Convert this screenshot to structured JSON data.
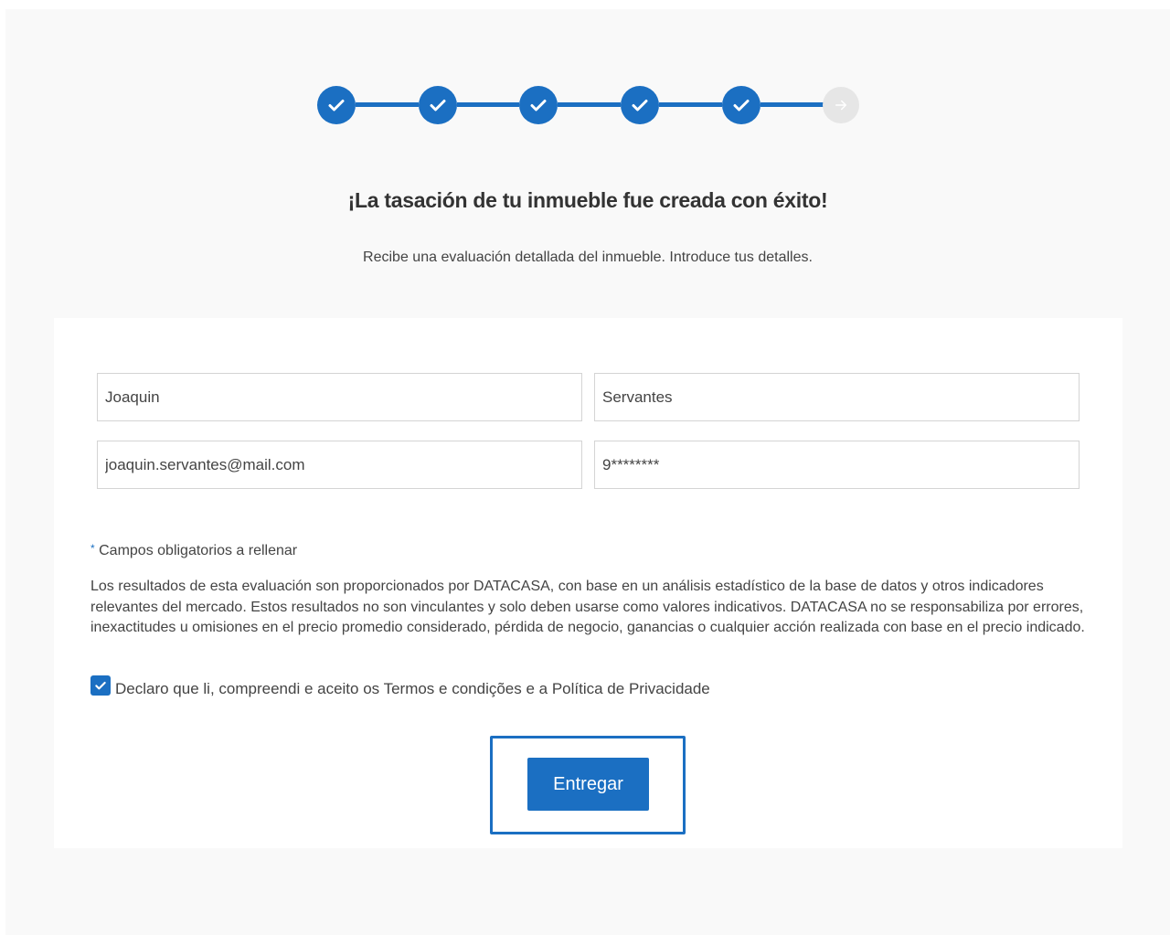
{
  "stepper": {
    "completed_icon": "check-icon",
    "pending_icon": "arrow-right-icon",
    "accent_color": "#1b6fc2",
    "pending_color": "#e6e6e6"
  },
  "header": {
    "title": "¡La tasación de tu inmueble fue creada con éxito!",
    "subtitle": "Recibe una evaluación detallada del inmueble. Introduce tus detalles."
  },
  "form": {
    "first_name": "Joaquin",
    "last_name": "Servantes",
    "email": "joaquin.servantes@mail.com",
    "phone": "9********",
    "required_star": "*",
    "required_note": "Campos obligatorios a rellenar",
    "disclaimer": "Los resultados de esta evaluación son proporcionados por DATACASA, con base en un análisis estadístico de la base de datos y otros indicadores relevantes del mercado. Estos resultados no son vinculantes y solo deben usarse como valores indicativos. DATACASA no se responsabiliza por errores, inexactitudes u omisiones en el precio promedio considerado, pérdida de negocio, ganancias o cualquier acción realizada con base en el precio indicado.",
    "consent_label": "Declaro que li, compreendi e aceito os Termos e condições e a Política de Privacidade",
    "consent_checked": true,
    "submit_label": "Entregar"
  }
}
